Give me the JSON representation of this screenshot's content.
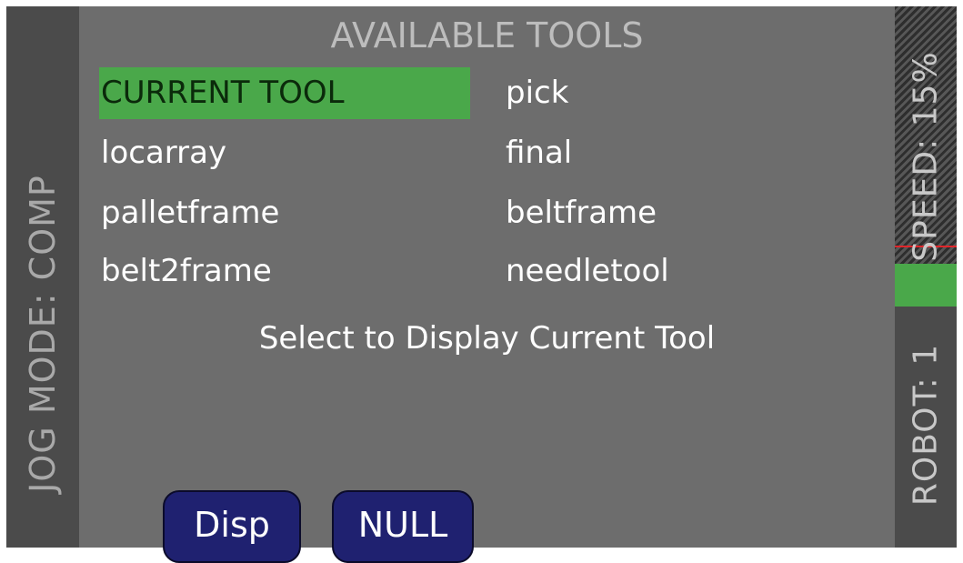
{
  "left_bar": {
    "jog_mode": "JOG MODE: COMP"
  },
  "main": {
    "title": "AVAILABLE TOOLS",
    "tools": [
      {
        "label": "CURRENT TOOL",
        "selected": true
      },
      {
        "label": "pick",
        "selected": false
      },
      {
        "label": "locarray",
        "selected": false
      },
      {
        "label": "final",
        "selected": false
      },
      {
        "label": "palletframe",
        "selected": false
      },
      {
        "label": "beltframe",
        "selected": false
      },
      {
        "label": "belt2frame",
        "selected": false
      },
      {
        "label": "needletool",
        "selected": false
      }
    ],
    "hint": "Select to Display Current Tool",
    "buttons": {
      "disp": "Disp",
      "null": "NULL"
    }
  },
  "right_bar": {
    "speed": "SPEED: 15%",
    "speed_percent": 15,
    "robot": "ROBOT: 1"
  },
  "colors": {
    "panel_bg": "#6d6d6d",
    "selection_green": "#4aa84a",
    "button_navy": "#1f2170",
    "speed_marker_red": "#e0262b"
  }
}
